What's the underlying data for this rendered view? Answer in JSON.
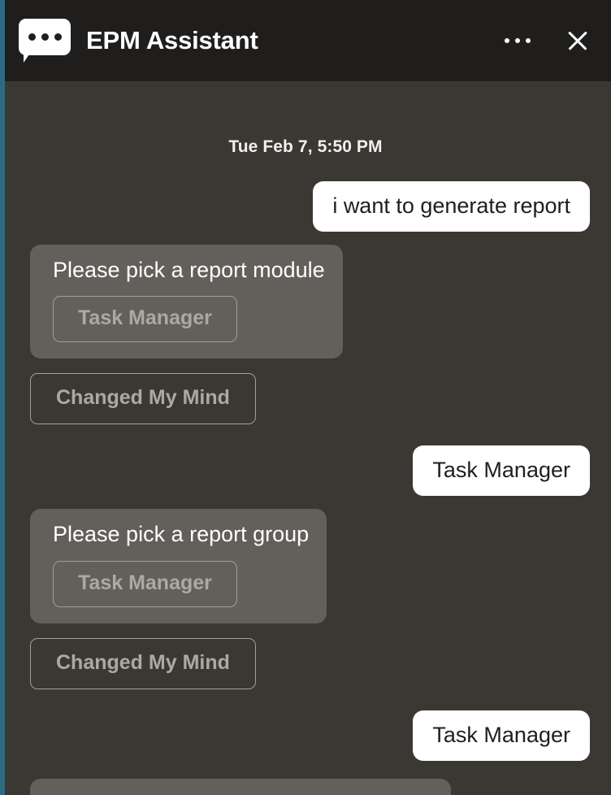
{
  "header": {
    "title": "EPM Assistant",
    "logo_icon": "chat-bubble-dots-icon",
    "more_icon": "ellipsis-icon",
    "close_icon": "close-icon",
    "background": "#201E1C"
  },
  "theme": {
    "accent_rail": "#30697F",
    "chat_background": "#3B3833",
    "bot_bubble": "#635F5A",
    "user_bubble": "#FFFFFF",
    "chip_border": "#A39E99",
    "chip_text": "#ADA8A2"
  },
  "conversation": {
    "daystamp": "Tue Feb 7, 5:50 PM",
    "messages": [
      {
        "role": "user",
        "text": "i want to generate report"
      },
      {
        "role": "assistant",
        "text": "Please pick a report module",
        "choices": [
          "Task Manager"
        ]
      },
      {
        "role": "action",
        "text": "Changed My Mind"
      },
      {
        "role": "user",
        "text": "Task Manager"
      },
      {
        "role": "assistant",
        "text": "Please pick a report group",
        "choices": [
          "Task Manager"
        ]
      },
      {
        "role": "action",
        "text": "Changed My Mind"
      },
      {
        "role": "user",
        "text": "Task Manager"
      },
      {
        "role": "assistant",
        "text": "",
        "partial": true
      }
    ]
  }
}
